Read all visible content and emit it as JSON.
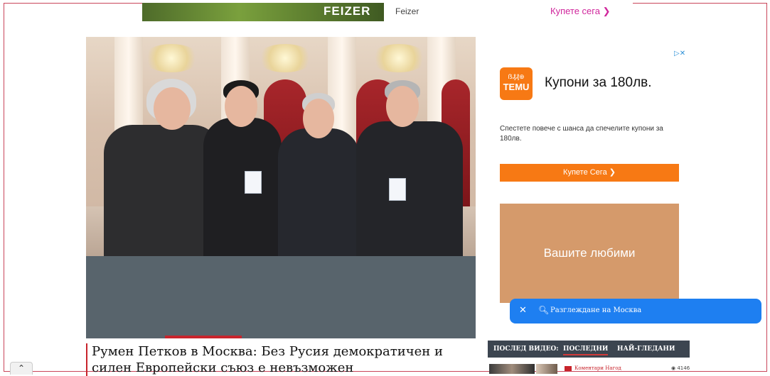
{
  "top_ad": {
    "brand": "FEIZER",
    "advertiser": "Feizer",
    "cta": "Купете сега ❯"
  },
  "side_ad": {
    "logo_top": "ẞ₰₰⊕",
    "logo_bottom": "TEMU",
    "title": "Купони за 180лв.",
    "text": "Спестете повече с шанса да спечелите купони за 180лв.",
    "button": "Купете Сега ❯",
    "promo": "Вашите любими",
    "adchoices_icon": "adchoices-icon"
  },
  "search_pill": {
    "close": "✕",
    "query": "Разглеждане на Москва"
  },
  "article": {
    "headline": "Румен Петков в Москва: Без Русия демократичен и силен Европейски съюз е невъзможен",
    "video_progress": 0.2
  },
  "video_bar": {
    "label": "ПОСЛЕД ВИДЕО:",
    "tab_latest": "ПОСЛЕДНИ",
    "tab_most": "НАЙ-ГЛЕДАНИ"
  },
  "video_item": {
    "title": "Коментари Нагод",
    "views": "4146"
  },
  "scroll_top": {
    "label": "⌃"
  },
  "colors": {
    "accent": "#c8242c",
    "temu": "#f77914",
    "pill": "#1e7ff1",
    "frame": "#c9455a"
  }
}
